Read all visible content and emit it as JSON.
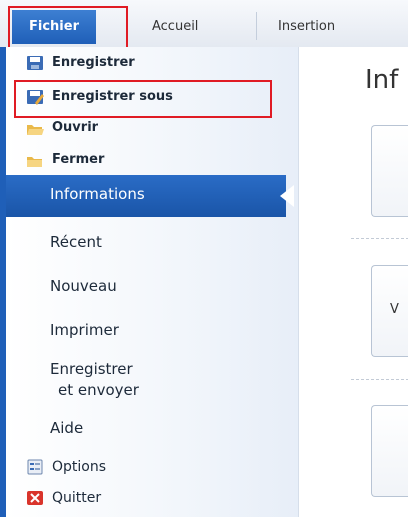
{
  "tabs": {
    "file": "Fichier",
    "home": "Accueil",
    "insert": "Insertion"
  },
  "sidebar": {
    "commands": [
      {
        "label": "Enregistrer",
        "icon": "save-icon"
      },
      {
        "label": "Enregistrer sous",
        "icon": "save-as-icon"
      },
      {
        "label": "Ouvrir",
        "icon": "open-folder-icon"
      },
      {
        "label": "Fermer",
        "icon": "close-folder-icon"
      }
    ],
    "nav": {
      "info": "Informations",
      "recent": "Récent",
      "new": "Nouveau",
      "print": "Imprimer",
      "send_line1": "Enregistrer",
      "send_line2": "et envoyer",
      "help": "Aide"
    },
    "bottom": [
      {
        "label": "Options",
        "icon": "options-icon"
      },
      {
        "label": "Quitter",
        "icon": "exit-icon"
      }
    ]
  },
  "content": {
    "title": "Inf",
    "card2_text": "V"
  },
  "colors": {
    "accent": "#1f5fb8",
    "highlight_box": "#e01b24"
  }
}
